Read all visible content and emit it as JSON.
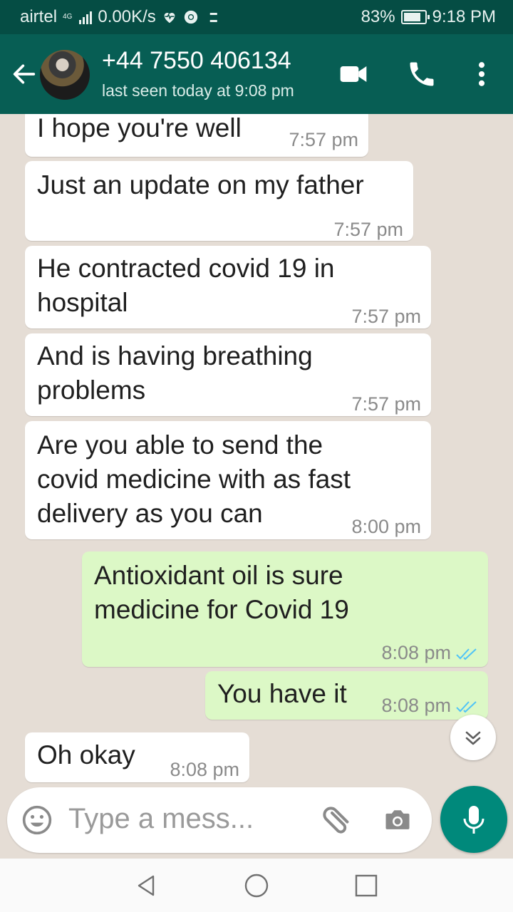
{
  "status_bar": {
    "carrier": "airtel",
    "network_type": "4G",
    "speed": "0.00K/s",
    "battery": "83%",
    "battery_level": 0.83,
    "time": "9:18 PM",
    "icons": [
      "heart-rate-icon",
      "chrome-icon",
      "news-icon"
    ]
  },
  "header": {
    "contact_name": "+44 7550 406134",
    "last_seen": "last seen today at 9:08 pm",
    "icons": [
      "back-arrow-icon",
      "video-call-icon",
      "phone-call-icon",
      "more-options-icon"
    ]
  },
  "messages": [
    {
      "direction": "in",
      "lines": [
        "I hope you're well"
      ],
      "time": "7:57 pm"
    },
    {
      "direction": "in",
      "lines": [
        "Just an update on my father"
      ],
      "time": "7:57 pm"
    },
    {
      "direction": "in",
      "lines": [
        "He contracted covid 19 in",
        "hospital"
      ],
      "time": "7:57 pm"
    },
    {
      "direction": "in",
      "lines": [
        "And is having breathing",
        "problems"
      ],
      "time": "7:57 pm"
    },
    {
      "direction": "in",
      "lines": [
        "Are you able to send the",
        "covid medicine with as fast",
        "delivery as you can"
      ],
      "time": "8:00 pm"
    },
    {
      "direction": "out",
      "lines": [
        "Antioxidant oil is sure",
        "medicine for Covid 19"
      ],
      "time": "8:08 pm",
      "status": "read"
    },
    {
      "direction": "out",
      "lines": [
        "You have it"
      ],
      "time": "8:08 pm",
      "status": "read"
    },
    {
      "direction": "in",
      "lines": [
        "Oh okay"
      ],
      "time": "8:08 pm"
    }
  ],
  "composer": {
    "placeholder": "Type a mess..."
  },
  "colors": {
    "header": "#075e54",
    "status_bar": "#054d44",
    "chat_background": "#e5ddd5",
    "outgoing_bubble": "#dcf8c6",
    "incoming_bubble": "#ffffff",
    "read_ticks": "#4fc3f7",
    "mic_button": "#00897b"
  }
}
